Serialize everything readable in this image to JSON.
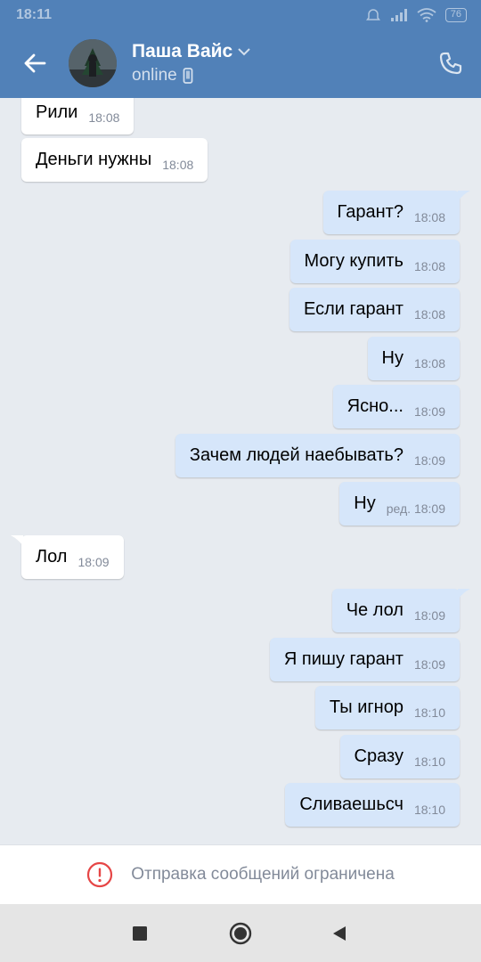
{
  "status_bar": {
    "time": "18:11",
    "battery": "76"
  },
  "header": {
    "contact_name": "Паша Вайс",
    "contact_status": "online",
    "colors": {
      "background": "#5181b8",
      "text": "#ffffff"
    }
  },
  "messages": [
    {
      "direction": "in",
      "text": "Рили",
      "time": "18:08"
    },
    {
      "direction": "in",
      "text": "Деньги нужны",
      "time": "18:08"
    },
    {
      "direction": "out",
      "text": "Гарант?",
      "time": "18:08"
    },
    {
      "direction": "out",
      "text": "Могу купить",
      "time": "18:08"
    },
    {
      "direction": "out",
      "text": "Если гарант",
      "time": "18:08"
    },
    {
      "direction": "out",
      "text": "Ну",
      "time": "18:08"
    },
    {
      "direction": "out",
      "text": "Ясно...",
      "time": "18:09"
    },
    {
      "direction": "out",
      "text": "Зачем людей наебывать?",
      "time": "18:09"
    },
    {
      "direction": "out",
      "text": "Ну",
      "time": "ред. 18:09"
    },
    {
      "direction": "in",
      "text": "Лол",
      "time": "18:09"
    },
    {
      "direction": "out",
      "text": "Че лол",
      "time": "18:09"
    },
    {
      "direction": "out",
      "text": "Я пишу гарант",
      "time": "18:09"
    },
    {
      "direction": "out",
      "text": "Ты игнор",
      "time": "18:10"
    },
    {
      "direction": "out",
      "text": "Сразу",
      "time": "18:10"
    },
    {
      "direction": "out",
      "text": "Сливаешьсч",
      "time": "18:10"
    }
  ],
  "restriction": {
    "text": "Отправка сообщений ограничена",
    "icon": "alert-circle-icon",
    "color": "#e64646"
  },
  "navbar": {
    "buttons": [
      "recent-apps-icon",
      "home-icon",
      "back-triangle-icon"
    ]
  }
}
